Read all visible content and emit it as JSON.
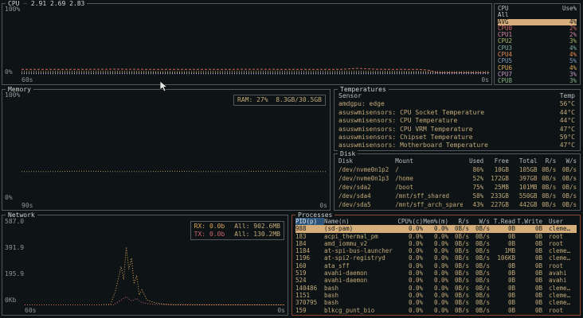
{
  "colors": {
    "background": "#0e1316",
    "border": "#53585c",
    "focused_border": "#8a4532",
    "selected_bg": "#d6ae7b",
    "selected_fg": "#15191c",
    "sorted_header_bg": "#2b5278",
    "entry_text": "#c2aa78",
    "axis_text": "#8d9598"
  },
  "cpu_graph": {
    "title": "CPU",
    "load_avg": "2.91 2.69 2.83",
    "y_labels": [
      "100%",
      "0%"
    ],
    "x_labels": [
      "60s",
      "0s"
    ],
    "series": [
      {
        "name": "cpu-busy",
        "color": "#cc6666",
        "dash": "3,2",
        "points": [
          [
            0,
            8
          ],
          [
            10,
            8
          ],
          [
            20,
            8.3
          ],
          [
            30,
            8
          ],
          [
            40,
            8
          ],
          [
            50,
            8.2
          ],
          [
            60,
            8
          ],
          [
            68,
            8
          ],
          [
            72,
            9.5
          ],
          [
            76,
            8.2
          ],
          [
            80,
            8
          ],
          [
            85,
            8
          ],
          [
            87,
            7
          ],
          [
            89,
            3
          ],
          [
            100,
            3
          ]
        ]
      },
      {
        "name": "avg",
        "color": "#d8a657",
        "dash": "1,2",
        "points": [
          [
            0,
            5
          ],
          [
            15,
            5.2
          ],
          [
            30,
            4.8
          ],
          [
            45,
            5
          ],
          [
            60,
            5.2
          ],
          [
            75,
            5
          ],
          [
            90,
            4.6
          ],
          [
            100,
            4.8
          ]
        ]
      },
      {
        "name": "cpu2",
        "color": "#a9b665",
        "dash": "1,2",
        "points": [
          [
            0,
            3
          ],
          [
            20,
            3.2
          ],
          [
            40,
            2.8
          ],
          [
            60,
            3
          ],
          [
            80,
            3.1
          ],
          [
            100,
            3
          ]
        ]
      },
      {
        "name": "cpu3",
        "color": "#7daea3",
        "dash": "1,2",
        "points": [
          [
            0,
            2
          ],
          [
            25,
            2.2
          ],
          [
            50,
            1.8
          ],
          [
            75,
            2
          ],
          [
            100,
            2
          ]
        ]
      },
      {
        "name": "cpu5",
        "color": "#7d9bbd",
        "dash": "1,2",
        "points": [
          [
            0,
            1.4
          ],
          [
            30,
            1.5
          ],
          [
            60,
            1.3
          ],
          [
            100,
            1.5
          ]
        ]
      },
      {
        "name": "cpu7",
        "color": "#c397c3",
        "dash": "1,2",
        "points": [
          [
            0,
            2.6
          ],
          [
            35,
            2.4
          ],
          [
            70,
            2.7
          ],
          [
            100,
            2.5
          ]
        ]
      }
    ]
  },
  "cpu_list": {
    "headers": [
      "CPU",
      "Use%"
    ],
    "rows": [
      {
        "cells": [
          "All",
          ""
        ],
        "color": "#c8ccc6"
      },
      {
        "cells": [
          "AVG",
          "4%"
        ],
        "selected": true
      },
      {
        "cells": [
          "CPU0",
          "2%"
        ],
        "color": "#cc6666"
      },
      {
        "cells": [
          "CPU1",
          "2%"
        ],
        "color": "#d3869b"
      },
      {
        "cells": [
          "CPU2",
          "3%"
        ],
        "color": "#a9b665"
      },
      {
        "cells": [
          "CPU3",
          "4%"
        ],
        "color": "#7daea3"
      },
      {
        "cells": [
          "CPU4",
          "4%"
        ],
        "color": "#e78a4e"
      },
      {
        "cells": [
          "CPU5",
          "5%"
        ],
        "color": "#7d9bbd"
      },
      {
        "cells": [
          "CPU6",
          "4%"
        ],
        "color": "#d8a657"
      },
      {
        "cells": [
          "CPU7",
          "3%"
        ],
        "color": "#c397c3"
      },
      {
        "cells": [
          "CPU8",
          "3%"
        ],
        "color": "#89b482"
      }
    ]
  },
  "memory": {
    "title": "Memory",
    "y_labels": [
      "100%",
      "0%"
    ],
    "x_labels": [
      "90s",
      "0s"
    ],
    "legend": {
      "label": "RAM: 27%",
      "value": "8.3GB/30.5GB"
    },
    "series": [
      {
        "name": "ram",
        "color": "#a79763",
        "dash": "1,2",
        "points": [
          [
            0,
            27
          ],
          [
            10,
            27
          ],
          [
            20,
            27.5
          ],
          [
            30,
            27
          ],
          [
            40,
            27
          ],
          [
            50,
            27.3
          ],
          [
            60,
            27
          ],
          [
            70,
            27
          ],
          [
            80,
            27.4
          ],
          [
            90,
            27
          ],
          [
            100,
            27
          ]
        ]
      }
    ]
  },
  "temperatures": {
    "title": "Temperatures",
    "headers": [
      "Sensor",
      "Temp"
    ],
    "rows": [
      {
        "cells": [
          "amdgpu: edge",
          "56°C"
        ]
      },
      {
        "cells": [
          "asuswmisensors: CPU Socket Temperature",
          "44°C"
        ]
      },
      {
        "cells": [
          "asuswmisensors: CPU Temperature",
          "44°C"
        ]
      },
      {
        "cells": [
          "asuswmisensors: CPU VRM Temperature",
          "47°C"
        ]
      },
      {
        "cells": [
          "asuswmisensors: Chipset Temperature",
          "59°C"
        ]
      },
      {
        "cells": [
          "asuswmisensors: Motherboard Temperature",
          "47°C"
        ]
      }
    ]
  },
  "disk": {
    "title": "Disk",
    "headers": [
      "Disk",
      "Mount",
      "Used",
      "Free",
      "Total",
      "R/s",
      "W/s"
    ],
    "rows": [
      {
        "cells": [
          "/dev/nvme0n1p2",
          "/",
          "86%",
          "10GB",
          "105GB",
          "0B/s",
          "0B/s"
        ]
      },
      {
        "cells": [
          "/dev/nvme0n1p3",
          "/home",
          "52%",
          "172GB",
          "397GB",
          "0B/s",
          "0B/s"
        ]
      },
      {
        "cells": [
          "/dev/sda2",
          "/boot",
          "75%",
          "25MB",
          "101MB",
          "0B/s",
          "0B/s"
        ]
      },
      {
        "cells": [
          "/dev/sda4",
          "/mnt/sff_shared",
          "58%",
          "233GB",
          "550GB",
          "0B/s",
          "0B/s"
        ]
      },
      {
        "cells": [
          "/dev/sda5",
          "/mnt/sff_arch_spare",
          "43%",
          "227GB",
          "442GB",
          "0B/s",
          "0B/s"
        ]
      }
    ]
  },
  "network": {
    "title": "Network",
    "y_labels": [
      "587.0",
      "391.9",
      "195.9",
      "0Kb"
    ],
    "x_labels": [
      "60s",
      "0s"
    ],
    "legend": {
      "rx": "RX: 0.0b",
      "rx_total": "All: 902.6MB",
      "tx": "TX: 0.0b",
      "tx_total": "All: 130.2MB"
    },
    "series": [
      {
        "name": "rx",
        "color": "#d8a657",
        "dash": "1,2",
        "points": [
          [
            0,
            0.5
          ],
          [
            28,
            0.5
          ],
          [
            33,
            1
          ],
          [
            35,
            18
          ],
          [
            37,
            45
          ],
          [
            38,
            30
          ],
          [
            39,
            68
          ],
          [
            40,
            42
          ],
          [
            41,
            55
          ],
          [
            42,
            25
          ],
          [
            43,
            35
          ],
          [
            44,
            12
          ],
          [
            45,
            18
          ],
          [
            47,
            6
          ],
          [
            50,
            3
          ],
          [
            54,
            1
          ],
          [
            58,
            0.5
          ],
          [
            100,
            0.5
          ]
        ]
      },
      {
        "name": "tx",
        "color": "#cc6666",
        "dash": "1,2",
        "points": [
          [
            0,
            0.3
          ],
          [
            34,
            0.3
          ],
          [
            37,
            6
          ],
          [
            39,
            10
          ],
          [
            41,
            5
          ],
          [
            43,
            8
          ],
          [
            45,
            3
          ],
          [
            50,
            1
          ],
          [
            100,
            0.3
          ]
        ]
      }
    ]
  },
  "processes": {
    "title": "Processes",
    "headers": [
      "PID(p)",
      "Name(n)",
      "CPU%(c)",
      "Mem%(m)",
      "R/s",
      "W/s",
      "T.Read",
      "T.Write",
      "User"
    ],
    "rows": [
      {
        "cells": [
          "988",
          "(sd-pam)",
          "0.0%",
          "0.0%",
          "0B/s",
          "0B/s",
          "0B",
          "0B",
          "cleme…"
        ],
        "selected": true
      },
      {
        "cells": [
          "183",
          "acpi_thermal_pm",
          "0.0%",
          "0.0%",
          "0B/s",
          "0B/s",
          "0B",
          "0B",
          "root"
        ]
      },
      {
        "cells": [
          "184",
          "amd_iommu_v2",
          "0.0%",
          "0.0%",
          "0B/s",
          "0B/s",
          "0B",
          "0B",
          "root"
        ]
      },
      {
        "cells": [
          "1184",
          "at-spi-bus-launcher",
          "0.0%",
          "0.0%",
          "0B/s",
          "0B/s",
          "1MB",
          "0B",
          "cleme…"
        ]
      },
      {
        "cells": [
          "1196",
          "at-spi2-registryd",
          "0.0%",
          "0.0%",
          "0B/s",
          "0B/s",
          "106KB",
          "0B",
          "cleme…"
        ]
      },
      {
        "cells": [
          "160",
          "ata_sff",
          "0.0%",
          "0.0%",
          "0B/s",
          "0B/s",
          "0B",
          "0B",
          "root"
        ]
      },
      {
        "cells": [
          "519",
          "avahi-daemon",
          "0.0%",
          "0.0%",
          "0B/s",
          "0B/s",
          "0B",
          "0B",
          "avahi"
        ]
      },
      {
        "cells": [
          "524",
          "avahi-daemon",
          "0.0%",
          "0.0%",
          "0B/s",
          "0B/s",
          "0B",
          "0B",
          "avahi"
        ]
      },
      {
        "cells": [
          "140486",
          "bash",
          "0.0%",
          "0.0%",
          "0B/s",
          "0B/s",
          "0B",
          "0B",
          "cleme…"
        ]
      },
      {
        "cells": [
          "1151",
          "bash",
          "0.0%",
          "0.0%",
          "0B/s",
          "0B/s",
          "0B",
          "0B",
          "cleme…"
        ]
      },
      {
        "cells": [
          "370795",
          "bash",
          "0.0%",
          "0.0%",
          "0B/s",
          "0B/s",
          "0B",
          "0B",
          "cleme…"
        ]
      },
      {
        "cells": [
          "159",
          "blkcg_punt_bio",
          "0.0%",
          "0.0%",
          "0B/s",
          "0B/s",
          "0B",
          "0B",
          "root"
        ]
      }
    ]
  }
}
